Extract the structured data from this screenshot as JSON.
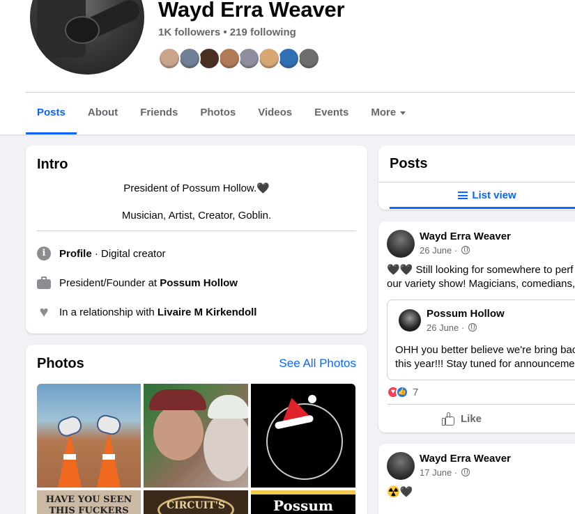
{
  "profile": {
    "name": "Wayd Erra Weaver",
    "followers_text": "1K followers • 219 following"
  },
  "friend_avatars": [
    {
      "name": "friend-avatar-1",
      "color": "#c9a48b"
    },
    {
      "name": "friend-avatar-2",
      "color": "#6f7f95"
    },
    {
      "name": "friend-avatar-3",
      "color": "#4a2e22"
    },
    {
      "name": "friend-avatar-4",
      "color": "#b07a56"
    },
    {
      "name": "friend-avatar-5",
      "color": "#8e8ea0"
    },
    {
      "name": "friend-avatar-6",
      "color": "#d8a874"
    },
    {
      "name": "friend-avatar-7",
      "color": "#2f6fb3"
    },
    {
      "name": "friend-avatar-8",
      "color": "#6d6d6d"
    }
  ],
  "tabs": [
    {
      "label": "Posts",
      "active": true
    },
    {
      "label": "About"
    },
    {
      "label": "Friends"
    },
    {
      "label": "Photos"
    },
    {
      "label": "Videos"
    },
    {
      "label": "Events"
    },
    {
      "label": "More"
    }
  ],
  "intro": {
    "title": "Intro",
    "bio_line_1": "President of Possum Hollow.🖤",
    "bio_line_2": "Musician, Artist, Creator, Goblin.",
    "profile_label": "Profile",
    "profile_value": " · Digital creator",
    "work_prefix": "President/Founder at ",
    "work_place": "Possum Hollow",
    "relationship_prefix": "In a relationship with ",
    "relationship_name": "Livaire M Kirkendoll"
  },
  "photos": {
    "title": "Photos",
    "see_all": "See All Photos",
    "tile_texts": [
      "HAVE YOU SEEN",
      "THIS FUCKERS",
      "CIRCUIT'S",
      "Possum Hollow"
    ]
  },
  "posts": {
    "title": "Posts",
    "list_view": "List view",
    "post1": {
      "author": "Wayd Erra Weaver",
      "date": "26 June · ",
      "text_line_1": "🖤🖤 Still looking for somewhere to perf",
      "text_line_2": "our variety show! Magicians, comedians, j",
      "shared_author": "Possum Hollow",
      "shared_date": "26 June · ",
      "shared_line_1": "OHH you better believe we're bring bac",
      "shared_line_2": "this year!!! Stay tuned for announcemen",
      "reaction_count": "7",
      "like_label": "Like"
    },
    "post2": {
      "author": "Wayd Erra Weaver",
      "date": "17 June · ",
      "text": "☢️🖤"
    }
  },
  "colors": {
    "accent": "#0866ff",
    "secondary_text": "#65676b",
    "background": "#f0f2f5"
  }
}
